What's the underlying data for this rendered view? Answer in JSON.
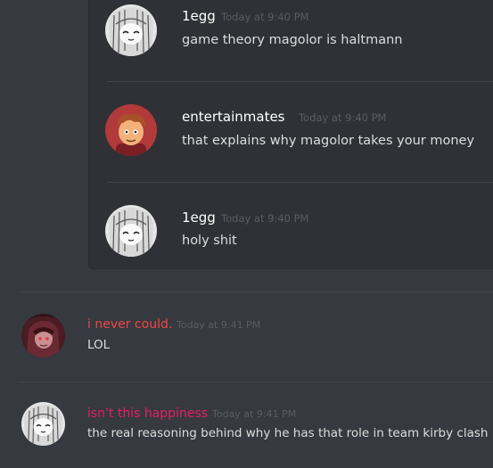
{
  "embed_messages": [
    {
      "author": "1egg",
      "timestamp": "Today at 9:40 PM",
      "text": "game theory magolor is haltmann",
      "name_color": "#ffffff",
      "avatar_icon": "sketch-girl-avatar"
    },
    {
      "author": "entertainmates",
      "timestamp": "Today at 9:40 PM",
      "text": "that explains why magolor takes your money",
      "name_color": "#ffffff",
      "avatar_icon": "cartoon-boy-avatar"
    },
    {
      "author": "1egg",
      "timestamp": "Today at 9:40 PM",
      "text": "holy shit",
      "name_color": "#ffffff",
      "avatar_icon": "sketch-girl-avatar"
    }
  ],
  "messages": [
    {
      "author": "i never could.",
      "timestamp": "Today at 9:41 PM",
      "text": "LOL",
      "name_color": "#f04747",
      "avatar_icon": "dark-anime-avatar"
    },
    {
      "author": "isn't this happiness",
      "timestamp": "Today at 9:41 PM",
      "text": "the real reasoning behind why he has that role in team kirby clash",
      "name_color": "#e91e63",
      "avatar_icon": "sketch-girl-avatar"
    }
  ],
  "colors": {
    "background": "#36393f",
    "embed_background": "#2f3136",
    "divider": "#42454b",
    "timestamp": "#5a5d63",
    "text": "#dcddde"
  }
}
